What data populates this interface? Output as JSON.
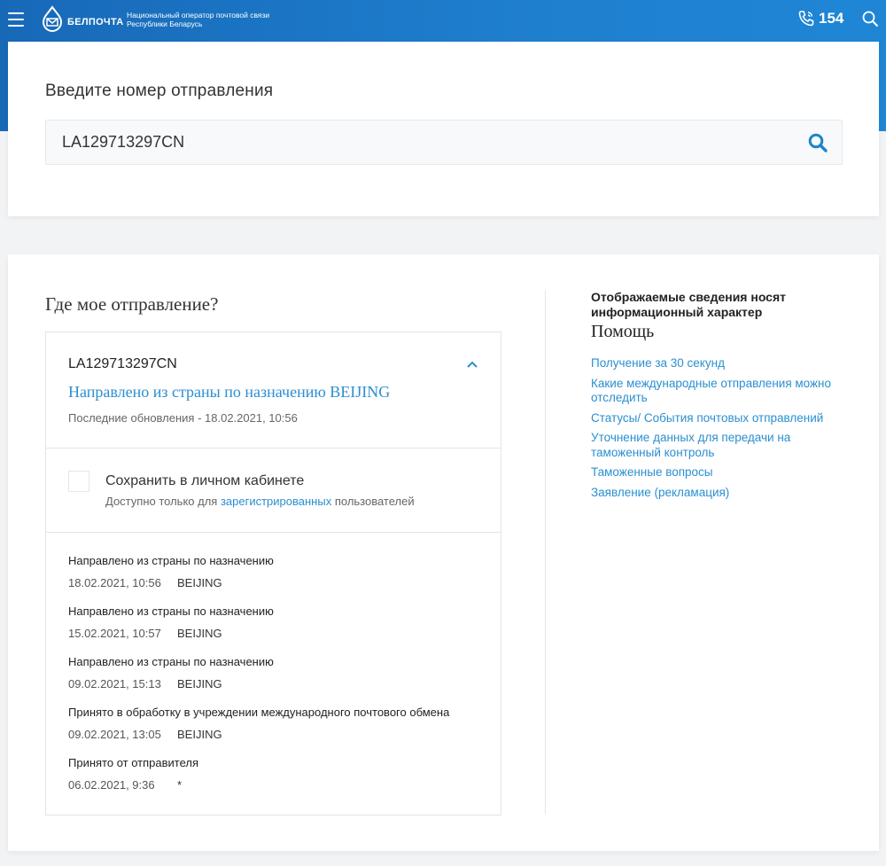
{
  "header": {
    "brand": "БЕЛПОЧТА",
    "operator_line1": "Национальный оператор почтовой связи",
    "operator_line2": "Республики Беларусь",
    "phone": "154",
    "icons": {
      "menu": "menu-icon",
      "phone": "phone-icon",
      "search": "search-icon"
    },
    "colors": {
      "bar": "#1769b8",
      "accent": "#2a8fd0"
    }
  },
  "search": {
    "title": "Введите номер отправления",
    "value": "LA129713297CN"
  },
  "tracking": {
    "title": "Где мое отправление?",
    "number": "LA129713297CN",
    "status": "Направлено из страны по назначению BEIJING",
    "updated": "Последние обновления - 18.02.2021, 10:56",
    "save_label": "Сохранить в личном кабинете",
    "save_sub_prefix": "Доступно только для ",
    "save_sub_link": "зарегистрированных",
    "save_sub_suffix": " пользователей",
    "events": [
      {
        "title": "Направлено из страны по назначению",
        "date": "18.02.2021, 10:56",
        "place": "BEIJING"
      },
      {
        "title": "Направлено из страны по назначению",
        "date": "15.02.2021, 10:57",
        "place": "BEIJING"
      },
      {
        "title": "Направлено из страны по назначению",
        "date": "09.02.2021, 15:13",
        "place": "BEIJING"
      },
      {
        "title": "Принято в обработку в учреждении международного почтового обмена",
        "date": "09.02.2021, 13:05",
        "place": "BEIJING"
      },
      {
        "title": "Принято от отправителя",
        "date": "06.02.2021, 9:36",
        "place": "*"
      }
    ]
  },
  "sidebar": {
    "note": "Отображаемые сведения носят информационный характер",
    "help_title": "Помощь",
    "links": [
      "Получение за 30 секунд",
      "Какие международные отправления можно отследить",
      "Статусы/ События почтовых отправлений",
      "Уточнение данных для передачи на таможенный контроль",
      "Таможенные вопросы",
      "Заявление (рекламация)"
    ]
  }
}
